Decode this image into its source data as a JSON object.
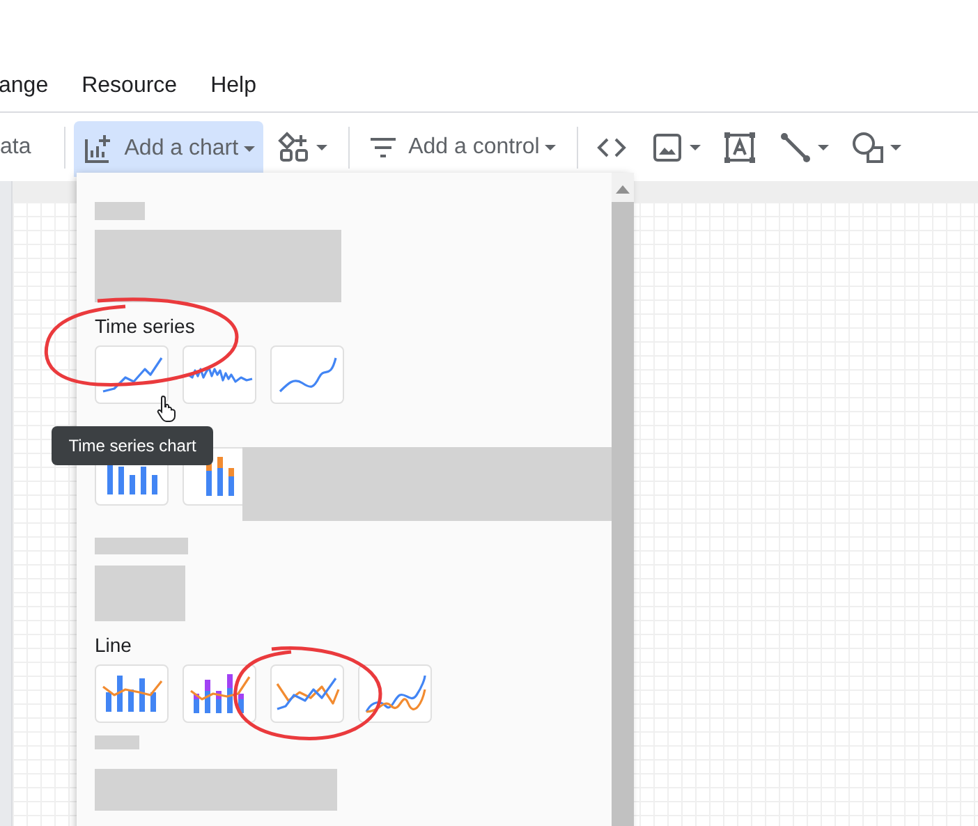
{
  "menu": [
    {
      "label": "ange"
    },
    {
      "label": "Resource"
    },
    {
      "label": "Help"
    }
  ],
  "toolbar": [
    {
      "kind": "text",
      "label": "ata"
    },
    {
      "kind": "divider"
    },
    {
      "kind": "chart",
      "label": "Add a chart",
      "selected": true
    },
    {
      "kind": "component",
      "selected": false
    },
    {
      "kind": "divider"
    },
    {
      "kind": "control",
      "label": "Add a control",
      "selected": false
    },
    {
      "kind": "divider"
    },
    {
      "kind": "embed",
      "selected": false
    },
    {
      "kind": "image",
      "selected": false
    },
    {
      "kind": "textbox",
      "selected": false
    },
    {
      "kind": "line",
      "selected": false
    },
    {
      "kind": "shape",
      "selected": false
    }
  ],
  "chart_menu": {
    "sections": [
      {
        "kind": "blank-wide"
      },
      {
        "kind": "group",
        "title": "Time series",
        "tiles": [
          {
            "kind": "timeseries"
          },
          {
            "kind": "sparkline"
          },
          {
            "kind": "smooth"
          }
        ]
      },
      {
        "kind": "group",
        "tiles": [
          {
            "kind": "bar"
          },
          {
            "kind": "stacked-bar"
          },
          {
            "kind": "redacted"
          }
        ]
      },
      {
        "kind": "blank-narrow"
      },
      {
        "kind": "group",
        "title": "Line",
        "tiles": [
          {
            "kind": "combo"
          },
          {
            "kind": "stacked-combo"
          },
          {
            "kind": "line"
          },
          {
            "kind": "smooth-line"
          }
        ]
      },
      {
        "kind": "blank-row"
      }
    ]
  },
  "tooltip": {
    "text": "Time series chart"
  }
}
